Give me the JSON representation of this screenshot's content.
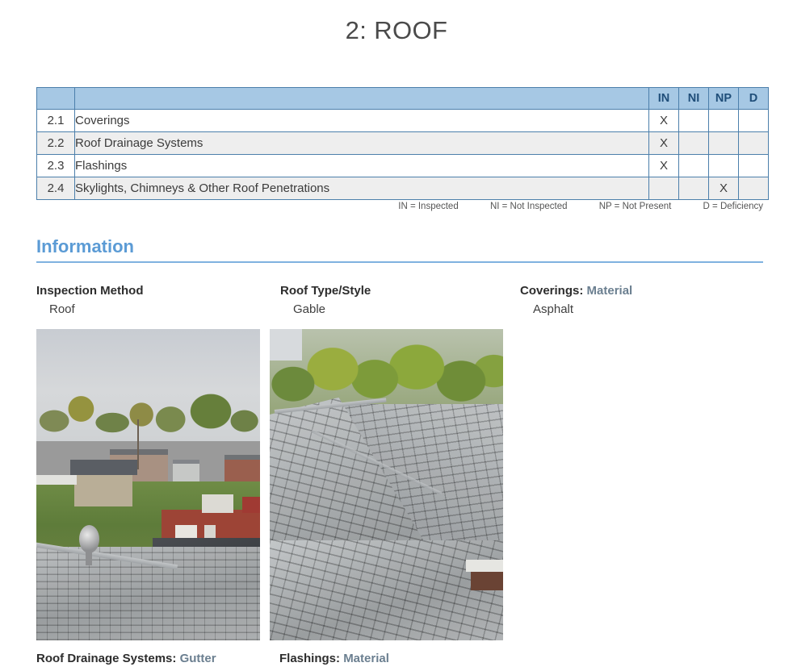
{
  "page": {
    "title": "2: ROOF"
  },
  "summary_table": {
    "headers": [
      "",
      "",
      "IN",
      "NI",
      "NP",
      "D"
    ],
    "rows": [
      {
        "number": "2.1",
        "name": "Coverings",
        "IN": "X",
        "NI": "",
        "NP": "",
        "D": ""
      },
      {
        "number": "2.2",
        "name": "Roof Drainage Systems",
        "IN": "X",
        "NI": "",
        "NP": "",
        "D": ""
      },
      {
        "number": "2.3",
        "name": "Flashings",
        "IN": "X",
        "NI": "",
        "NP": "",
        "D": ""
      },
      {
        "number": "2.4",
        "name": "Skylights, Chimneys & Other Roof Penetrations",
        "IN": "",
        "NI": "",
        "NP": "X",
        "D": ""
      }
    ],
    "legend": [
      "IN = Inspected",
      "NI = Not Inspected",
      "NP = Not Present",
      "D = Deficiency"
    ]
  },
  "information": {
    "heading": "Information",
    "fields": [
      {
        "label": "Inspection Method",
        "qualifier": "",
        "value": "Roof"
      },
      {
        "label": "Roof Type/Style",
        "qualifier": "",
        "value": "Gable"
      },
      {
        "label": "Coverings:",
        "qualifier": "Material",
        "value": "Asphalt"
      }
    ]
  },
  "photos": [
    {
      "caption": "",
      "alt": "Aerial view from roof over neighborhood with shingles in foreground"
    },
    {
      "caption": "",
      "alt": "Close view of gray asphalt shingle roof ridge and valley"
    }
  ],
  "bottom_captions": [
    {
      "label": "Roof Drainage Systems:",
      "qualifier": "Gutter"
    },
    {
      "label": "Flashings:",
      "qualifier": "Material"
    }
  ],
  "colors": {
    "header_blue": "#a6c8e4",
    "header_text": "#1f4e79",
    "table_border": "#4c7fab",
    "alt_row": "#eeeeee",
    "section_heading": "#5b9bd5",
    "section_rule": "#7fb2e0",
    "qualifier_text": "#6b7f90",
    "body_text": "#3b3b3b"
  }
}
